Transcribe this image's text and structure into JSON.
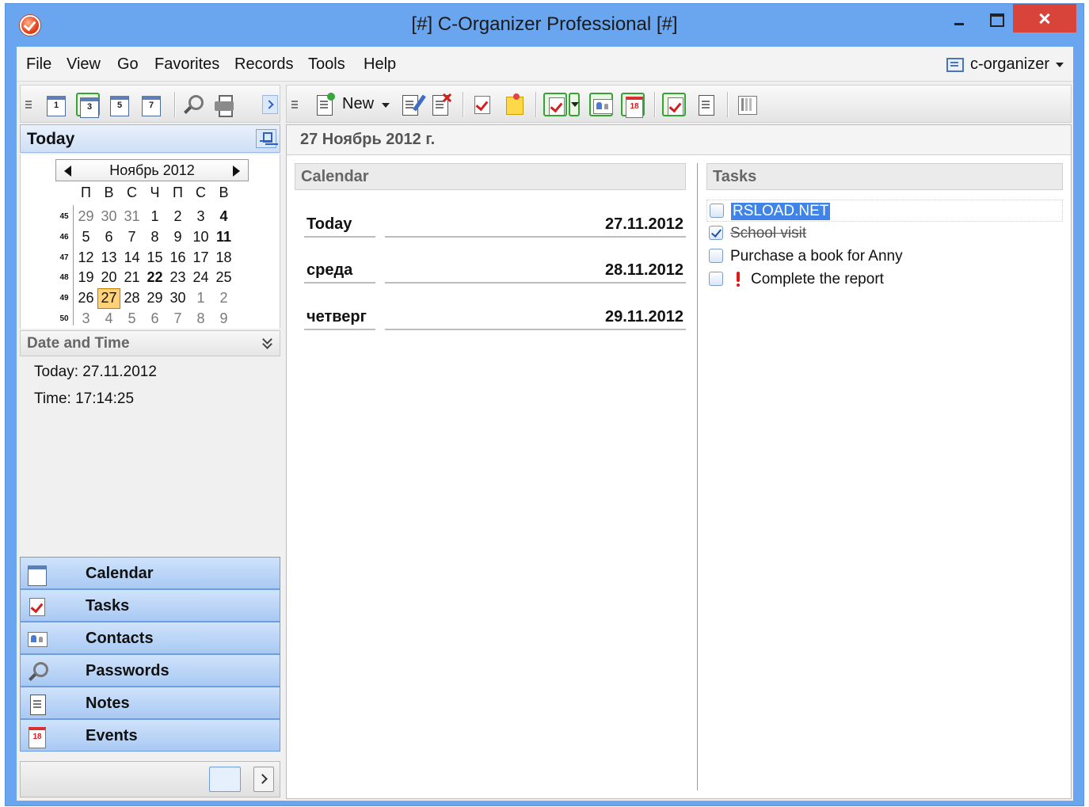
{
  "window": {
    "title": "[#] C-Organizer Professional [#]"
  },
  "menu": {
    "items": [
      "File",
      "View",
      "Go",
      "Favorites",
      "Records",
      "Tools",
      "Help"
    ],
    "profile": "c-organizer"
  },
  "toolbar_left": {
    "icons": [
      "calendar-day-icon",
      "calendar-3day-icon",
      "calendar-5day-icon",
      "calendar-week-icon",
      "search-icon",
      "print-icon"
    ],
    "day_numbers": [
      "1",
      "3",
      "5",
      "7"
    ]
  },
  "toolbar_right": {
    "new_label": "New",
    "event_day": "18"
  },
  "today_panel": {
    "title": "Today",
    "month_label": "Ноябрь 2012",
    "weekdays": [
      "П",
      "В",
      "С",
      "Ч",
      "П",
      "С",
      "В"
    ],
    "weeks": [
      {
        "num": "45",
        "days": [
          {
            "d": "29",
            "muted": true
          },
          {
            "d": "30",
            "muted": true
          },
          {
            "d": "31",
            "muted": true
          },
          {
            "d": "1"
          },
          {
            "d": "2"
          },
          {
            "d": "3"
          },
          {
            "d": "4",
            "bold": true
          }
        ]
      },
      {
        "num": "46",
        "days": [
          {
            "d": "5"
          },
          {
            "d": "6"
          },
          {
            "d": "7"
          },
          {
            "d": "8"
          },
          {
            "d": "9"
          },
          {
            "d": "10"
          },
          {
            "d": "11",
            "bold": true
          }
        ]
      },
      {
        "num": "47",
        "days": [
          {
            "d": "12"
          },
          {
            "d": "13"
          },
          {
            "d": "14"
          },
          {
            "d": "15"
          },
          {
            "d": "16"
          },
          {
            "d": "17"
          },
          {
            "d": "18"
          }
        ]
      },
      {
        "num": "48",
        "days": [
          {
            "d": "19"
          },
          {
            "d": "20"
          },
          {
            "d": "21"
          },
          {
            "d": "22",
            "bold": true
          },
          {
            "d": "23"
          },
          {
            "d": "24"
          },
          {
            "d": "25"
          }
        ]
      },
      {
        "num": "49",
        "days": [
          {
            "d": "26"
          },
          {
            "d": "27",
            "selected": true
          },
          {
            "d": "28"
          },
          {
            "d": "29"
          },
          {
            "d": "30"
          },
          {
            "d": "1",
            "muted": true
          },
          {
            "d": "2",
            "muted": true
          }
        ]
      },
      {
        "num": "50",
        "days": [
          {
            "d": "3",
            "muted": true
          },
          {
            "d": "4",
            "muted": true
          },
          {
            "d": "5",
            "muted": true
          },
          {
            "d": "6",
            "muted": true
          },
          {
            "d": "7",
            "muted": true
          },
          {
            "d": "8",
            "muted": true
          },
          {
            "d": "9",
            "muted": true
          }
        ]
      }
    ]
  },
  "date_time": {
    "title": "Date and Time",
    "today_line": "Today: 27.11.2012",
    "time_line": "Time: 17:14:25"
  },
  "nav": {
    "items": [
      {
        "label": "Calendar",
        "icon": "calendar-icon"
      },
      {
        "label": "Tasks",
        "icon": "tasks-icon"
      },
      {
        "label": "Contacts",
        "icon": "contacts-icon"
      },
      {
        "label": "Passwords",
        "icon": "passwords-icon"
      },
      {
        "label": "Notes",
        "icon": "notes-icon"
      },
      {
        "label": "Events",
        "icon": "events-icon"
      }
    ],
    "events_day": "18"
  },
  "main": {
    "date_title": "27 Ноябрь 2012 г.",
    "calendar_title": "Calendar",
    "days": [
      {
        "name": "Today",
        "date": "27.11.2012"
      },
      {
        "name": "среда",
        "date": "28.11.2012"
      },
      {
        "name": "четверг",
        "date": "29.11.2012"
      }
    ],
    "tasks_title": "Tasks",
    "tasks": [
      {
        "text": "RSLOAD.NET",
        "checked": false,
        "highlighted": true
      },
      {
        "text": "School visit",
        "checked": true,
        "done": true
      },
      {
        "text": "Purchase a book for Anny",
        "checked": false
      },
      {
        "text": "Complete the report",
        "checked": false,
        "priority": "high"
      }
    ]
  },
  "colors": {
    "title_bar": "#6aa6ef",
    "close_button": "#d9443a",
    "nav_button": "#a9c9f3",
    "selected_day": "#ffd27a",
    "task_highlight": "#3f84e6",
    "priority": "#e01818"
  }
}
